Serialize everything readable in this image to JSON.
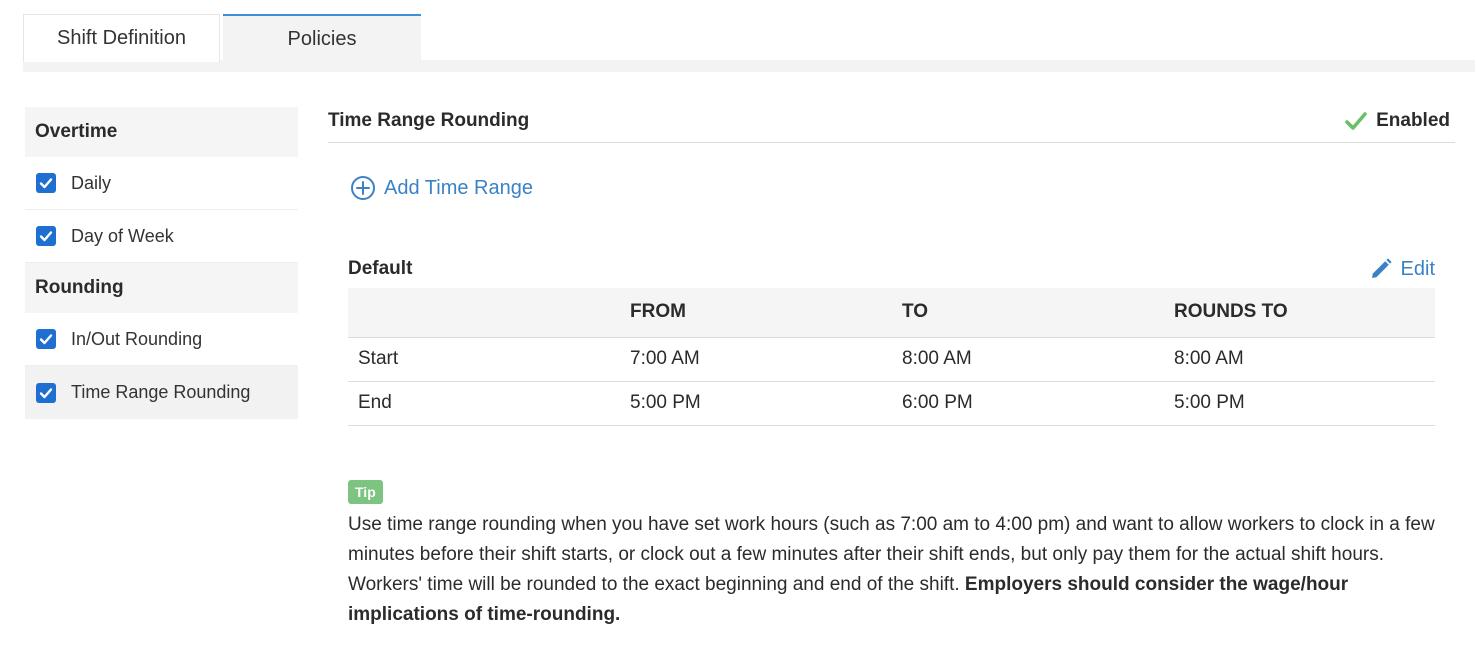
{
  "tabs": [
    {
      "label": "Shift Definition"
    },
    {
      "label": "Policies"
    }
  ],
  "sidebar": {
    "sections": [
      {
        "title": "Overtime",
        "items": [
          {
            "label": "Daily",
            "checked": true
          },
          {
            "label": "Day of Week",
            "checked": true
          }
        ]
      },
      {
        "title": "Rounding",
        "items": [
          {
            "label": "In/Out Rounding",
            "checked": true
          },
          {
            "label": "Time Range Rounding",
            "checked": true
          }
        ]
      }
    ]
  },
  "main": {
    "title": "Time Range Rounding",
    "status": "Enabled",
    "add_range_label": "Add Time Range",
    "section": {
      "title": "Default",
      "edit_label": "Edit",
      "columns": [
        "",
        "FROM",
        "TO",
        "ROUNDS TO"
      ],
      "rows": [
        {
          "label": "Start",
          "from": "7:00 AM",
          "to": "8:00 AM",
          "rounds_to": "8:00 AM"
        },
        {
          "label": "End",
          "from": "5:00 PM",
          "to": "6:00 PM",
          "rounds_to": "5:00 PM"
        }
      ]
    },
    "tip": {
      "badge": "Tip",
      "text": "Use time range rounding when you have set work hours (such as 7:00 am to 4:00 pm) and want to allow workers to clock in a few minutes before their shift starts, or clock out a few minutes after their shift ends, but only pay them for the actual shift hours. Workers' time will be rounded to the exact beginning and end of the shift.",
      "bold_text": "Employers should consider the wage/hour implications of time-rounding."
    }
  },
  "colors": {
    "accent": "#3b82c4",
    "checkbox": "#1f6fd1",
    "enabled_check": "#6abf69",
    "tip_badge": "#7cc47f"
  }
}
